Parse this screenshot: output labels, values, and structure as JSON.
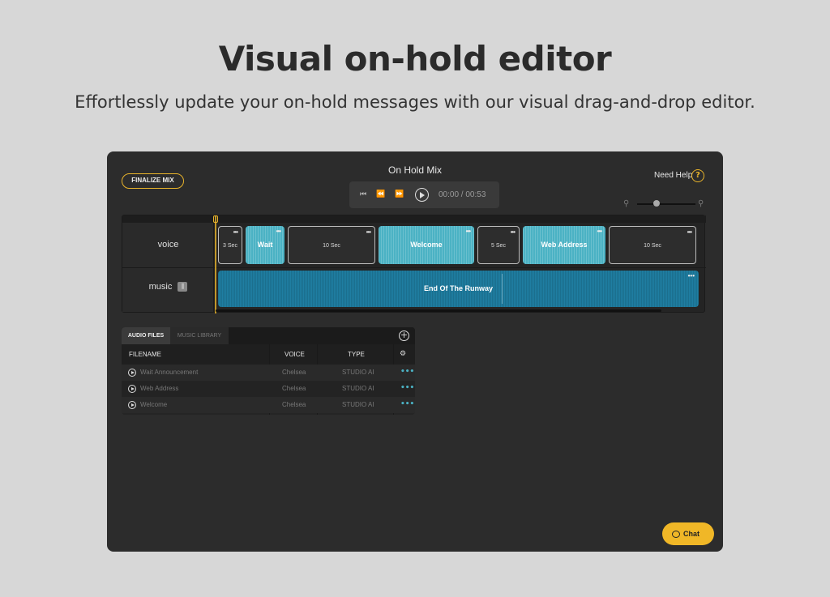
{
  "hero": {
    "title": "Visual on-hold editor",
    "subtitle": "Effortlessly update your on-hold messages with our visual drag-and-drop editor."
  },
  "toolbar": {
    "finalize_label": "FINALIZE MIX",
    "mix_title": "On Hold Mix",
    "time": "00:00 / 00:53",
    "help_label": "Need Help",
    "help_icon": "?"
  },
  "tracks": {
    "voice_label": "voice",
    "music_label": "music",
    "voice_clips": [
      {
        "label": "3 Sec",
        "type": "silence"
      },
      {
        "label": "Wait Anno...",
        "type": "voice"
      },
      {
        "label": "10 Sec",
        "type": "silence"
      },
      {
        "label": "Welcome",
        "type": "voice"
      },
      {
        "label": "5 Sec",
        "type": "silence"
      },
      {
        "label": "Web Address",
        "type": "voice"
      },
      {
        "label": "10 Sec",
        "type": "silence"
      }
    ],
    "music_clip": "End Of The Runway"
  },
  "files": {
    "tab_audio": "AUDIO FILES",
    "tab_music": "MUSIC LIBRARY",
    "columns": {
      "filename": "FILENAME",
      "voice": "VOICE",
      "type": "TYPE"
    },
    "rows": [
      {
        "filename": "Wait Announcement",
        "voice": "Chelsea",
        "type": "STUDIO AI"
      },
      {
        "filename": "Web Address",
        "voice": "Chelsea",
        "type": "STUDIO AI"
      },
      {
        "filename": "Welcome",
        "voice": "Chelsea",
        "type": "STUDIO AI"
      }
    ]
  },
  "chat": {
    "label": "Chat"
  },
  "colors": {
    "accent": "#e9b42b",
    "voice_clip": "#4bb2c4",
    "music_clip": "#1f7ea2",
    "panel": "#2c2c2c"
  }
}
